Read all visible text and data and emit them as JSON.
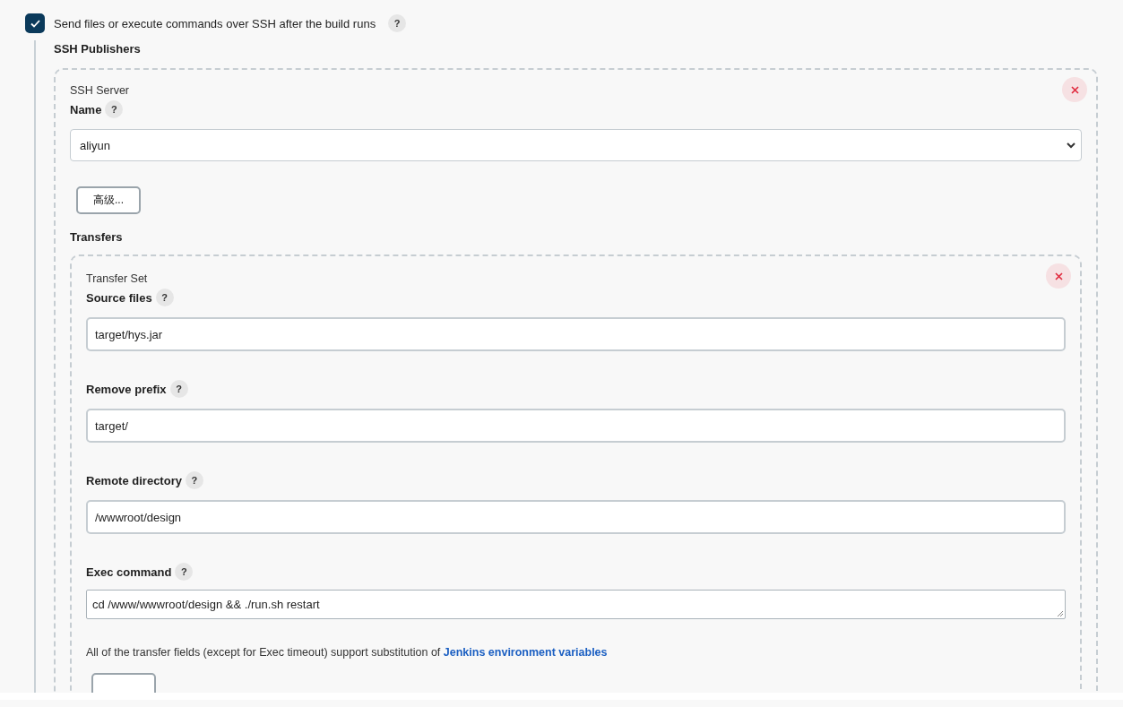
{
  "publish_option": {
    "label": "Send files or execute commands over SSH after the build runs",
    "checked": true,
    "help": "?"
  },
  "publishers_label": "SSH Publishers",
  "server": {
    "title": "SSH Server",
    "name_label": "Name",
    "help": "?",
    "value": "aliyun",
    "advanced_button": "高级..."
  },
  "transfers_label": "Transfers",
  "transfer_set": {
    "title": "Transfer Set",
    "fields": [
      {
        "kind": "input",
        "label": "Source files",
        "help": "?",
        "value": "target/hys.jar"
      },
      {
        "kind": "input",
        "label": "Remove prefix",
        "help": "?",
        "value": "target/"
      },
      {
        "kind": "input",
        "label": "Remote directory",
        "help": "?",
        "value": "/wwwroot/design"
      },
      {
        "kind": "textarea",
        "label": "Exec command",
        "help": "?",
        "value": "cd /www/wwwroot/design && ./run.sh restart"
      }
    ],
    "note": "All of the transfer fields (except for Exec timeout) support substitution of",
    "note_link": "Jenkins environment variables"
  }
}
